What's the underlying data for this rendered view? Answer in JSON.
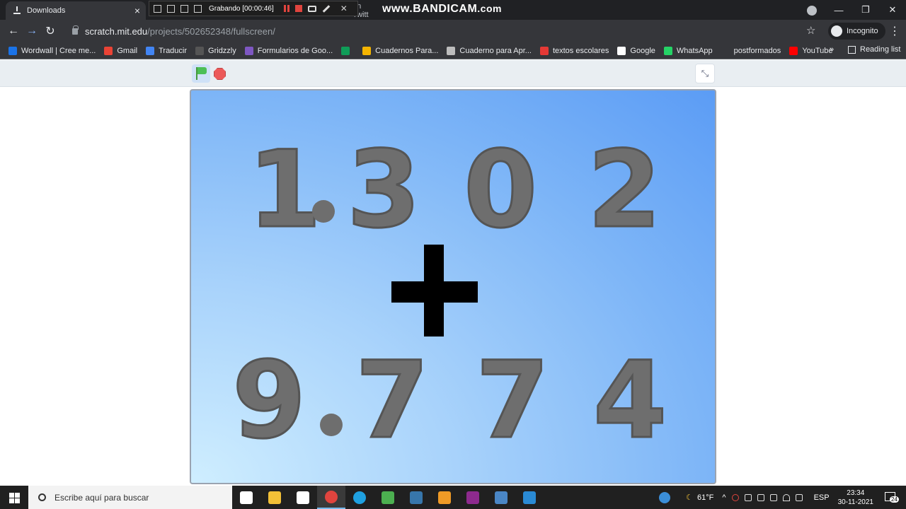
{
  "browser": {
    "tab_title": "Downloads",
    "tab_close": "×",
    "tab2_partial": "on Twitt",
    "window_controls": [
      "—",
      "❐",
      "✕"
    ],
    "url_host": "scratch.mit.edu",
    "url_path": "/projects/502652348/fullscreen/",
    "profile_label": "Incognito",
    "bookmarks_more": "»",
    "reading_list": "Reading list"
  },
  "recorder": {
    "status": "Grabando [00:00:46]",
    "watermark_main": "www.BANDICAM",
    "watermark_suffix": ".com",
    "close": "✕"
  },
  "bookmarks": [
    {
      "label": "Wordwall | Cree me...",
      "color": "#1a73e8"
    },
    {
      "label": "Gmail",
      "color": "#ea4335"
    },
    {
      "label": "Traducir",
      "color": "#4285f4"
    },
    {
      "label": "Gridzzly",
      "color": "#555555"
    },
    {
      "label": "Formularios de Goo...",
      "color": "#7e57c2"
    },
    {
      "label": "",
      "color": "#0f9d58"
    },
    {
      "label": "Cuadernos Para...",
      "color": "#f4b400"
    },
    {
      "label": "Cuaderno para Apr...",
      "color": "#bdbdbd"
    },
    {
      "label": "textos escolares",
      "color": "#e53935"
    },
    {
      "label": "Google",
      "color": "#ffffff"
    },
    {
      "label": "WhatsApp",
      "color": "#25d366"
    },
    {
      "label": "postformados",
      "color": "#35363a"
    },
    {
      "label": "YouTube",
      "color": "#ff0000"
    }
  ],
  "scratch": {
    "exit_fullscreen": "⤡"
  },
  "stage": {
    "top_number": [
      "1",
      ".",
      "3",
      "0",
      "2"
    ],
    "operator": "+",
    "bottom_number": [
      "9",
      ".",
      "7",
      "7",
      "4"
    ]
  },
  "taskbar": {
    "search_placeholder": "Escribe aquí para buscar",
    "weather": "61°F",
    "language": "ESP",
    "time": "23:34",
    "date": "30-11-2021",
    "notification_count": "24",
    "apps": [
      {
        "name": "task-view",
        "color": "#ffffff"
      },
      {
        "name": "file-explorer",
        "color": "#f2c037"
      },
      {
        "name": "geogebra",
        "color": "#ffffff"
      },
      {
        "name": "chrome",
        "color": "#e0443e"
      },
      {
        "name": "edge",
        "color": "#1fa0e0"
      },
      {
        "name": "green-app",
        "color": "#4caf50"
      },
      {
        "name": "python",
        "color": "#3776ab"
      },
      {
        "name": "video-player",
        "color": "#ef9a26"
      },
      {
        "name": "winrar",
        "color": "#8e2a8e"
      },
      {
        "name": "calculator",
        "color": "#4a86c5"
      },
      {
        "name": "media-app",
        "color": "#2a8ad4"
      }
    ]
  }
}
